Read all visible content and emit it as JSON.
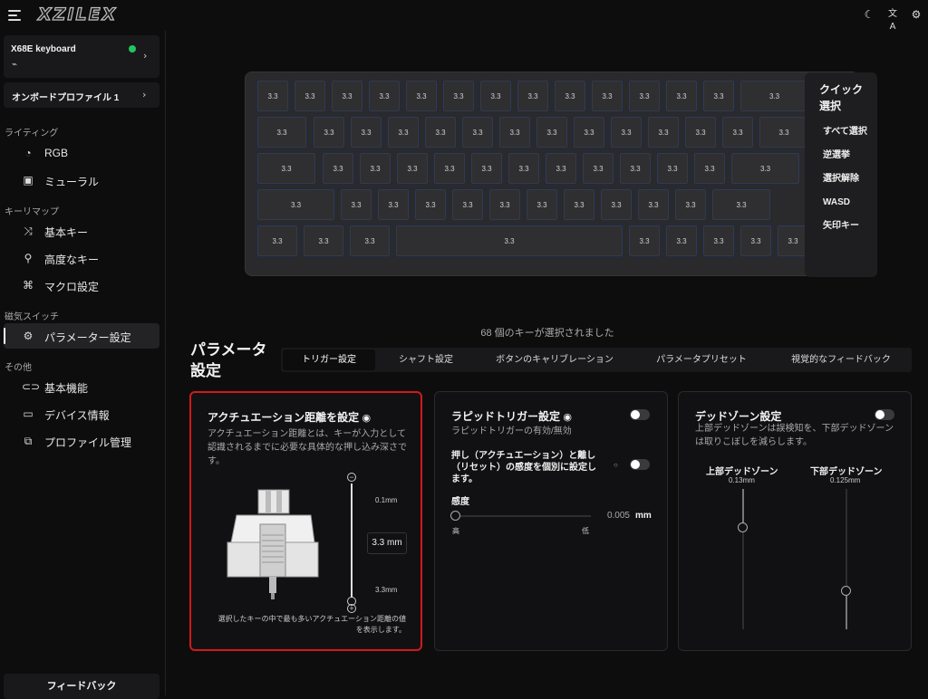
{
  "app": {
    "logo": "XZILEX"
  },
  "sidebar": {
    "device": {
      "name": "X68E keyboard"
    },
    "profile": {
      "label": "オンボードプロファイル 1"
    },
    "sections": [
      {
        "title": "ライティング",
        "items": [
          {
            "label": "RGB",
            "icon": "palette-icon"
          },
          {
            "label": "ミューラル",
            "icon": "image-icon"
          }
        ]
      },
      {
        "title": "キーリマップ",
        "items": [
          {
            "label": "基本キー",
            "icon": "shuffle-icon"
          },
          {
            "label": "高度なキー",
            "icon": "sliders-icon"
          },
          {
            "label": "マクロ設定",
            "icon": "command-icon"
          }
        ]
      },
      {
        "title": "磁気スイッチ",
        "items": [
          {
            "label": "パラメーター設定",
            "icon": "gear-icon"
          }
        ]
      },
      {
        "title": "その他",
        "items": [
          {
            "label": "基本機能",
            "icon": "toggle-icon"
          },
          {
            "label": "デバイス情報",
            "icon": "monitor-icon"
          },
          {
            "label": "プロファイル管理",
            "icon": "copy-icon"
          }
        ]
      }
    ],
    "feedback": "フィードバック"
  },
  "keyboard": {
    "key_label": "3.3"
  },
  "quick_select": {
    "title": "クイック選択",
    "buttons": [
      "すべて選択",
      "逆選挙",
      "選択解除",
      "WASD",
      "矢印キー"
    ]
  },
  "selected_count_text": "68 個のキーが選択されました",
  "parameters": {
    "title": "パラメータ設定",
    "tabs": [
      "トリガー設定",
      "シャフト設定",
      "ボタンのキャリブレーション",
      "パラメータプリセット",
      "視覚的なフィードバック"
    ],
    "active_tab": 0
  },
  "actuation": {
    "title": "アクチュエーション距離を設定",
    "desc": "アクチュエーション距離とは、キーが入力として認識されるまでに必要な具体的な押し込み深さです。",
    "min_label": "0.1mm",
    "max_label": "3.3mm",
    "value": "3.3 mm",
    "footnote": "選択したキーの中で最も多いアクチュエーション距離の値を表示します。",
    "slider_fraction": 1.0
  },
  "rapid": {
    "title": "ラピッドトリガー設定",
    "desc": "ラピッドトリガーの有効/無効",
    "separate_label": "押し（アクチュエーション）と離し（リセット）の感度を個別に設定します。",
    "sensitivity_label": "感度",
    "sensitivity_value": "0.005",
    "unit": "mm",
    "high": "高",
    "low": "低",
    "enabled": false
  },
  "deadzone": {
    "title": "デッドゾーン設定",
    "desc": "上部デッドゾーンは誤検知を、下部デッドゾーンは取りこぼしを減らします。",
    "upper_label": "上部デッドゾーン",
    "upper_value": "0.13mm",
    "lower_label": "下部デッドゾーン",
    "lower_value": "0.125mm",
    "enabled": false
  },
  "colors": {
    "accent_red": "#d11a1a",
    "status_green": "#22c55e"
  }
}
